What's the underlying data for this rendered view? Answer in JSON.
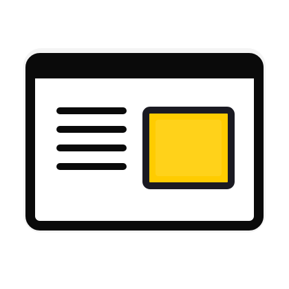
{
  "icon": {
    "name": "article-layout-icon",
    "colors": {
      "outline": "#0a0a0a",
      "window_fill": "#ffffff",
      "text_lines": "#0a0a0a",
      "image_fill": "#ffcc00",
      "image_inner": "#ffd21a",
      "image_border": "#1a1a22",
      "background": "#ffffff"
    }
  }
}
